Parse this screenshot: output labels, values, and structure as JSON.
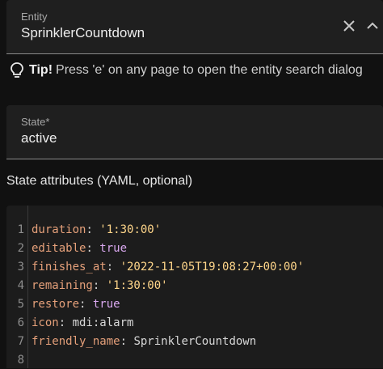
{
  "entity_field": {
    "label": "Entity",
    "value": "SprinklerCountdown"
  },
  "tip": {
    "strong": "Tip!",
    "text": "Press 'e' on any page to open the entity search dialog"
  },
  "state_field": {
    "label": "State*",
    "value": "active"
  },
  "attributes": {
    "heading": "State attributes (YAML, optional)",
    "lines": [
      {
        "num": "1",
        "key": "duration",
        "sep": ": ",
        "value": "'1:30:00'",
        "kind": "s"
      },
      {
        "num": "2",
        "key": "editable",
        "sep": ": ",
        "value": "true",
        "kind": "b"
      },
      {
        "num": "3",
        "key": "finishes_at",
        "sep": ": ",
        "value": "'2022-11-05T19:08:27+00:00'",
        "kind": "s"
      },
      {
        "num": "4",
        "key": "remaining",
        "sep": ": ",
        "value": "'1:30:00'",
        "kind": "s"
      },
      {
        "num": "5",
        "key": "restore",
        "sep": ": ",
        "value": "true",
        "kind": "b"
      },
      {
        "num": "6",
        "key": "icon",
        "sep": ": ",
        "value": "mdi:alarm",
        "kind": "p"
      },
      {
        "num": "7",
        "key": "friendly_name",
        "sep": ": ",
        "value": "SprinklerCountdown",
        "kind": "p"
      },
      {
        "num": "8",
        "key": "",
        "sep": "",
        "value": "",
        "kind": "p"
      }
    ]
  },
  "icons": {
    "clear": "close-icon",
    "dropdown": "menu-down-icon",
    "tip": "lightbulb-outline-icon"
  },
  "colors": {
    "background": "#111111",
    "field_bg": "#1f1f1f",
    "yaml_key": "#e5a07a",
    "yaml_string": "#ffd68a",
    "yaml_bool": "#d9a8ef"
  }
}
